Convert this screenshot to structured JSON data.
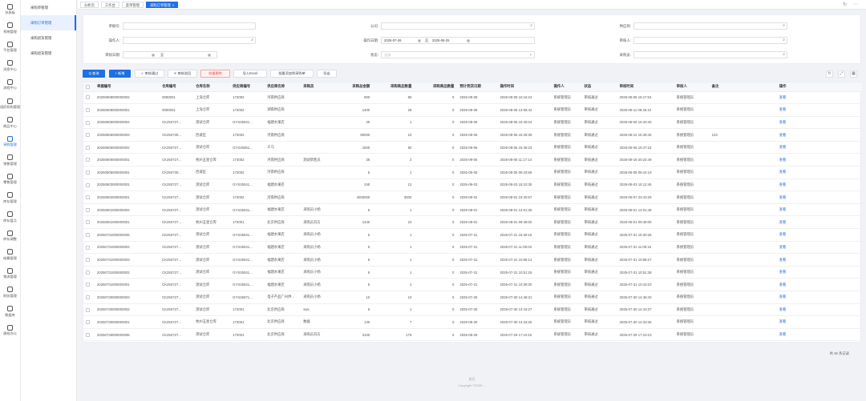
{
  "rail": [
    {
      "label": "仪表板",
      "icon": "home-icon"
    },
    {
      "label": "系统管理",
      "icon": "gear-icon"
    },
    {
      "label": "平台管理",
      "icon": "globe-icon"
    },
    {
      "label": "消息中心",
      "icon": "message-icon"
    },
    {
      "label": "流程中心",
      "icon": "flow-icon"
    },
    {
      "label": "组织机构管理",
      "icon": "org-icon"
    },
    {
      "label": "商品中心",
      "icon": "box-icon"
    },
    {
      "label": "采购管理",
      "icon": "cart-icon",
      "active": true
    },
    {
      "label": "销售管理",
      "icon": "sales-icon"
    },
    {
      "label": "零售管理",
      "icon": "retail-icon"
    },
    {
      "label": "库存管理",
      "icon": "warehouse-icon"
    },
    {
      "label": "库存盘点",
      "icon": "stocktake-icon"
    },
    {
      "label": "库存调整",
      "icon": "adjust-icon"
    },
    {
      "label": "结算管理",
      "icon": "settle-icon"
    },
    {
      "label": "物流管理",
      "icon": "truck-icon"
    },
    {
      "label": "财务管理",
      "icon": "finance-icon"
    },
    {
      "label": "数据库",
      "icon": "database-icon"
    },
    {
      "label": "绩效办公",
      "icon": "office-icon"
    }
  ],
  "submenu": [
    {
      "label": "采购单管理",
      "active": false
    },
    {
      "label": "采购订单管理",
      "active": true
    },
    {
      "label": "采购退货管理",
      "active": false
    },
    {
      "label": "采购退货管理",
      "active": false
    }
  ],
  "tabs": [
    {
      "label": "分析页",
      "active": false
    },
    {
      "label": "工作台",
      "active": false
    },
    {
      "label": "菜单管理",
      "active": false
    },
    {
      "label": "采购订单管理",
      "active": true
    }
  ],
  "search": {
    "order_no": {
      "label": "单据号:"
    },
    "supplier": {
      "label": "公司:"
    },
    "dept": {
      "label": "供应商:"
    },
    "operator": {
      "label": "操作人:"
    },
    "op_date": {
      "label": "操作日期:",
      "start": "2025-07-26",
      "sep": "至",
      "end": "2025-08-25"
    },
    "reviewer": {
      "label": "审核人:"
    },
    "review_date": {
      "label": "审核日期:",
      "sep": "至"
    },
    "status": {
      "label": "状态:",
      "placeholder": "全部"
    },
    "purchaser": {
      "label": "采购员:"
    }
  },
  "toolbar": {
    "search": "Q 查询",
    "add": "+ 新增",
    "approve": "✓ 审核通过",
    "reject": "✕ 审核驳回",
    "batch_delete": "批量删除",
    "import_excel": "导入Excel",
    "batch_purchase": "批量添加到采购单",
    "export": "导出"
  },
  "table": {
    "columns": [
      "单据编号",
      "仓库编号",
      "仓库名称",
      "供应商编号",
      "供应商名称",
      "采购员",
      "采购总金额",
      "采购商品数量",
      "采购商品数量",
      "预计到货日期",
      "操作时间",
      "操作人",
      "状态",
      "审核时间",
      "审核人",
      "备注",
      "操作"
    ],
    "rows": [
      [
        "20250808000000002",
        "0000001",
        "上海仓库",
        "173002",
        "河南供应商",
        "",
        "800",
        "80",
        "0",
        "2025-09-08",
        "2025-08-08 16:16:24",
        "系统管理员",
        "审核通过",
        "2025-08-08 16:17:04",
        "系统管理员",
        "",
        "查看"
      ],
      [
        "20250808000000001",
        "0000001",
        "上海仓库",
        "173002",
        "湖南供应商",
        "",
        "1400",
        "28",
        "0",
        "2025-09-08",
        "2025-08-08 13:55:42",
        "系统管理员",
        "审核通过",
        "2025-08-11 09:46:10",
        "系统管理员",
        "",
        "查看"
      ],
      [
        "20250806000000004",
        "CK250727...",
        "测试仓库",
        "GYS25041...",
        "福建水果店",
        "",
        "20",
        "1",
        "0",
        "2025-09-06",
        "2025-08-06 16:40:04",
        "系统管理员",
        "审核通过",
        "2025-08-06 16:40:40",
        "系统管理员",
        "",
        "查看"
      ],
      [
        "20250806000000003",
        "CK250730...",
        "西城区",
        "173002",
        "河南供应商",
        "",
        "80000",
        "10",
        "0",
        "2025-09-06",
        "2025-08-06 16:28:39",
        "系统管理员",
        "审核通过",
        "2025-08-12 16:48:46",
        "系统管理员",
        "123",
        "查看"
      ],
      [
        "20250806000000002",
        "CK250727...",
        "测试仓库",
        "GYS25051...",
        "义乌",
        "",
        "1500",
        "50",
        "0",
        "2025-09-06",
        "2025-08-06 15:46:23",
        "系统管理员",
        "审核通过",
        "2025-08-06 15:47:24",
        "系统管理员",
        "",
        "查看"
      ],
      [
        "20250806000000001",
        "CK250727...",
        "杭州五星仓库",
        "173002",
        "河南供应商",
        "测试销售员",
        "25",
        "2",
        "0",
        "2025-09-06",
        "2025-08-06 11:17:13",
        "系统管理员",
        "审核通过",
        "2025-08-18 20:24:49",
        "系统管理员",
        "",
        "查看"
      ],
      [
        "20250805000000001",
        "CK250730...",
        "西城区",
        "173002",
        "河南供应商",
        "",
        "5",
        "1",
        "0",
        "2025-09-05",
        "2025-08-05 09:43:58",
        "系统管理员",
        "审核通过",
        "2025-08-05 09:44:19",
        "系统管理员",
        "",
        "查看"
      ],
      [
        "20250803000000001",
        "CK250727...",
        "测试仓库",
        "GYS25041...",
        "福建水果店",
        "",
        "240",
        "12",
        "0",
        "2025-09-03",
        "2025-08-03 15:10:35",
        "系统管理员",
        "审核通过",
        "2025-08-03 15:12:46",
        "系统管理员",
        "",
        "查看"
      ],
      [
        "20250802000000001",
        "CK250727...",
        "测试仓库",
        "173002",
        "河南供应商",
        "",
        "4000000",
        "3000",
        "0",
        "2025-09-02",
        "2025-08-02 23:40:57",
        "系统管理员",
        "审核通过",
        "2025-08-07 23:43:29",
        "系统管理员",
        "",
        "查看"
      ],
      [
        "20250801000000002",
        "CK250727...",
        "测试仓库",
        "GYS25041...",
        "福建水果店",
        "采购员小杨",
        "5",
        "1",
        "0",
        "2025-09-01",
        "2025-08-01 14:01:35",
        "系统管理员",
        "审核通过",
        "2025-08-01 14:01:48",
        "系统管理员",
        "",
        "查看"
      ],
      [
        "20250801000000001",
        "CK250727...",
        "杭州五星仓库",
        "173001",
        "北京供应商",
        "采购员刘方",
        "1440",
        "24",
        "0",
        "2025-09-01",
        "2025-08-01 09:48:00",
        "系统管理员",
        "审核通过",
        "2025-08-01 09:48:05",
        "系统管理员",
        "",
        "查看"
      ],
      [
        "20250731000000005",
        "CK250727...",
        "测试仓库",
        "GYS25041...",
        "福建水果店",
        "采购员小杨",
        "5",
        "1",
        "0",
        "2025-07-31",
        "2025-07-31 15:30:15",
        "系统管理员",
        "审核通过",
        "2025-07-31 15:30:28",
        "系统管理员",
        "",
        "查看"
      ],
      [
        "20250731000000004",
        "CK250727...",
        "测试仓库",
        "GYS25041...",
        "福建水果店",
        "采购员小杨",
        "5",
        "1",
        "0",
        "2025-07-31",
        "2025-07-31 11:09:03",
        "系统管理员",
        "审核通过",
        "2025-07-31 11:09:16",
        "系统管理员",
        "",
        "查看"
      ],
      [
        "20250731000000003",
        "CK250727...",
        "测试仓库",
        "GYS25041...",
        "福建水果店",
        "采购员小杨",
        "5",
        "1",
        "0",
        "2025-07-31",
        "2025-07-31 10:58:14",
        "系统管理员",
        "审核通过",
        "2025-07-31 10:58:27",
        "系统管理员",
        "",
        "查看"
      ],
      [
        "20250731000000002",
        "CK250727...",
        "测试仓库",
        "GYS25041...",
        "福建水果店",
        "采购员小杨",
        "5",
        "1",
        "0",
        "2025-07-31",
        "2025-07-31 10:51:25",
        "系统管理员",
        "审核通过",
        "2025-07-31 10:51:38",
        "系统管理员",
        "",
        "查看"
      ],
      [
        "20250731000000001",
        "CK250727...",
        "测试仓库",
        "GYS25041...",
        "福建水果店",
        "采购员小杨",
        "5",
        "1",
        "0",
        "2025-07-31",
        "2025-07-31 10:39:30",
        "系统管理员",
        "审核通过",
        "2025-07-31 10:43:10",
        "系统管理员",
        "",
        "查看"
      ],
      [
        "20250730000000003",
        "CK250727...",
        "测试仓库",
        "GYS25071...",
        "电子产品广州供...",
        "采购员小杨",
        "10",
        "10",
        "0",
        "2025-07-30",
        "2025-07-30 14:48:31",
        "系统管理员",
        "审核通过",
        "2025-07-30 14:48:40",
        "系统管理员",
        "",
        "查看"
      ],
      [
        "20250730000000002",
        "CK250727...",
        "测试仓库",
        "173001",
        "北京供应商",
        "sws",
        "5",
        "1",
        "0",
        "2025-07-30",
        "2025-07-30 14:43:27",
        "系统管理员",
        "审核通过",
        "2025-07-30 14:43:37",
        "系统管理员",
        "",
        "查看"
      ],
      [
        "20250730000000001",
        "CK250727...",
        "杭州五星仓库",
        "173001",
        "北京供应商",
        "数据",
        "140",
        "7",
        "0",
        "2025-08-30",
        "2025-07-30 14:33:25",
        "系统管理员",
        "审核通过",
        "2025-07-30 14:33:36",
        "系统管理员",
        "",
        "查看"
      ],
      [
        "20250729000000006",
        "CK250727...",
        "测试仓库",
        "173001",
        "北京供应商",
        "采购员刘方",
        "3100",
        "176",
        "0",
        "2025-08-29",
        "2025-07-29 17:10:15",
        "系统管理员",
        "审核通过",
        "2025-07-29 17:10:23",
        "系统管理员",
        "",
        "查看"
      ]
    ]
  },
  "pager": "共 36 条记录",
  "footer": {
    "line1": "首页",
    "line2": "Copyright ©2025 ..."
  }
}
